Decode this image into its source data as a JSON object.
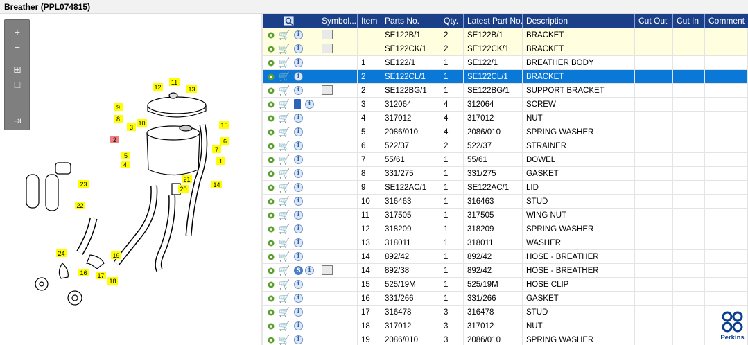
{
  "window": {
    "title": "Breather (PPL074815)"
  },
  "toolbox": {
    "zoom_in": "+",
    "zoom_out": "−",
    "fit": "⊞",
    "reset": "□",
    "export": "⇥"
  },
  "diagram_labels": [
    "1",
    "2",
    "3",
    "4",
    "5",
    "6",
    "7",
    "8",
    "9",
    "10",
    "11",
    "12",
    "13",
    "14",
    "15",
    "16",
    "17",
    "18",
    "19",
    "20",
    "21",
    "22",
    "23",
    "24"
  ],
  "grid": {
    "headers": {
      "icon": "",
      "symbol": "Symbol...",
      "item": "Item",
      "parts": "Parts No.",
      "qty": "Qty.",
      "latest": "Latest Part No.",
      "desc": "Description",
      "cutout": "Cut Out",
      "cutin": "Cut In",
      "comment": "Comment"
    },
    "rows": [
      {
        "item": "",
        "part": "SE122B/1",
        "qty": "2",
        "latest": "SE122B/1",
        "desc": "BRACKET",
        "sym": true,
        "style": "yellow"
      },
      {
        "item": "",
        "part": "SE122CK/1",
        "qty": "2",
        "latest": "SE122CK/1",
        "desc": "BRACKET",
        "sym": true,
        "style": "yellow"
      },
      {
        "item": "1",
        "part": "SE122/1",
        "qty": "1",
        "latest": "SE122/1",
        "desc": "BREATHER BODY",
        "style": ""
      },
      {
        "item": "2",
        "part": "SE122CL/1",
        "qty": "1",
        "latest": "SE122CL/1",
        "desc": "BRACKET",
        "style": "sel"
      },
      {
        "item": "2",
        "part": "SE122BG/1",
        "qty": "1",
        "latest": "SE122BG/1",
        "desc": "SUPPORT BRACKET",
        "sym": true,
        "style": ""
      },
      {
        "item": "3",
        "part": "312064",
        "qty": "4",
        "latest": "312064",
        "desc": "SCREW",
        "extra": "bookmark",
        "style": ""
      },
      {
        "item": "4",
        "part": "317012",
        "qty": "4",
        "latest": "317012",
        "desc": "NUT",
        "style": ""
      },
      {
        "item": "5",
        "part": "2086/010",
        "qty": "4",
        "latest": "2086/010",
        "desc": "SPRING WASHER",
        "style": ""
      },
      {
        "item": "6",
        "part": "522/37",
        "qty": "2",
        "latest": "522/37",
        "desc": "STRAINER",
        "style": ""
      },
      {
        "item": "7",
        "part": "55/61",
        "qty": "1",
        "latest": "55/61",
        "desc": "DOWEL",
        "style": ""
      },
      {
        "item": "8",
        "part": "331/275",
        "qty": "1",
        "latest": "331/275",
        "desc": "GASKET",
        "style": ""
      },
      {
        "item": "9",
        "part": "SE122AC/1",
        "qty": "1",
        "latest": "SE122AC/1",
        "desc": "LID",
        "style": ""
      },
      {
        "item": "10",
        "part": "316463",
        "qty": "1",
        "latest": "316463",
        "desc": "STUD",
        "style": ""
      },
      {
        "item": "11",
        "part": "317505",
        "qty": "1",
        "latest": "317505",
        "desc": "WING NUT",
        "style": ""
      },
      {
        "item": "12",
        "part": "318209",
        "qty": "1",
        "latest": "318209",
        "desc": "SPRING WASHER",
        "style": ""
      },
      {
        "item": "13",
        "part": "318011",
        "qty": "1",
        "latest": "318011",
        "desc": "WASHER",
        "style": ""
      },
      {
        "item": "14",
        "part": "892/42",
        "qty": "1",
        "latest": "892/42",
        "desc": "HOSE - BREATHER",
        "style": ""
      },
      {
        "item": "14",
        "part": "892/38",
        "qty": "1",
        "latest": "892/42",
        "desc": "HOSE - BREATHER",
        "extra": "s",
        "sym": true,
        "style": ""
      },
      {
        "item": "15",
        "part": "525/19M",
        "qty": "1",
        "latest": "525/19M",
        "desc": "HOSE CLIP",
        "style": ""
      },
      {
        "item": "16",
        "part": "331/266",
        "qty": "1",
        "latest": "331/266",
        "desc": "GASKET",
        "style": ""
      },
      {
        "item": "17",
        "part": "316478",
        "qty": "3",
        "latest": "316478",
        "desc": "STUD",
        "style": ""
      },
      {
        "item": "18",
        "part": "317012",
        "qty": "3",
        "latest": "317012",
        "desc": "NUT",
        "style": ""
      },
      {
        "item": "19",
        "part": "2086/010",
        "qty": "3",
        "latest": "2086/010",
        "desc": "SPRING WASHER",
        "style": ""
      }
    ]
  },
  "logo": {
    "text": "Perkins"
  },
  "colors": {
    "header": "#1c3f8a",
    "selected": "#0a78d7",
    "yellow": "#ffffe0",
    "gear": "#5aa02c"
  }
}
